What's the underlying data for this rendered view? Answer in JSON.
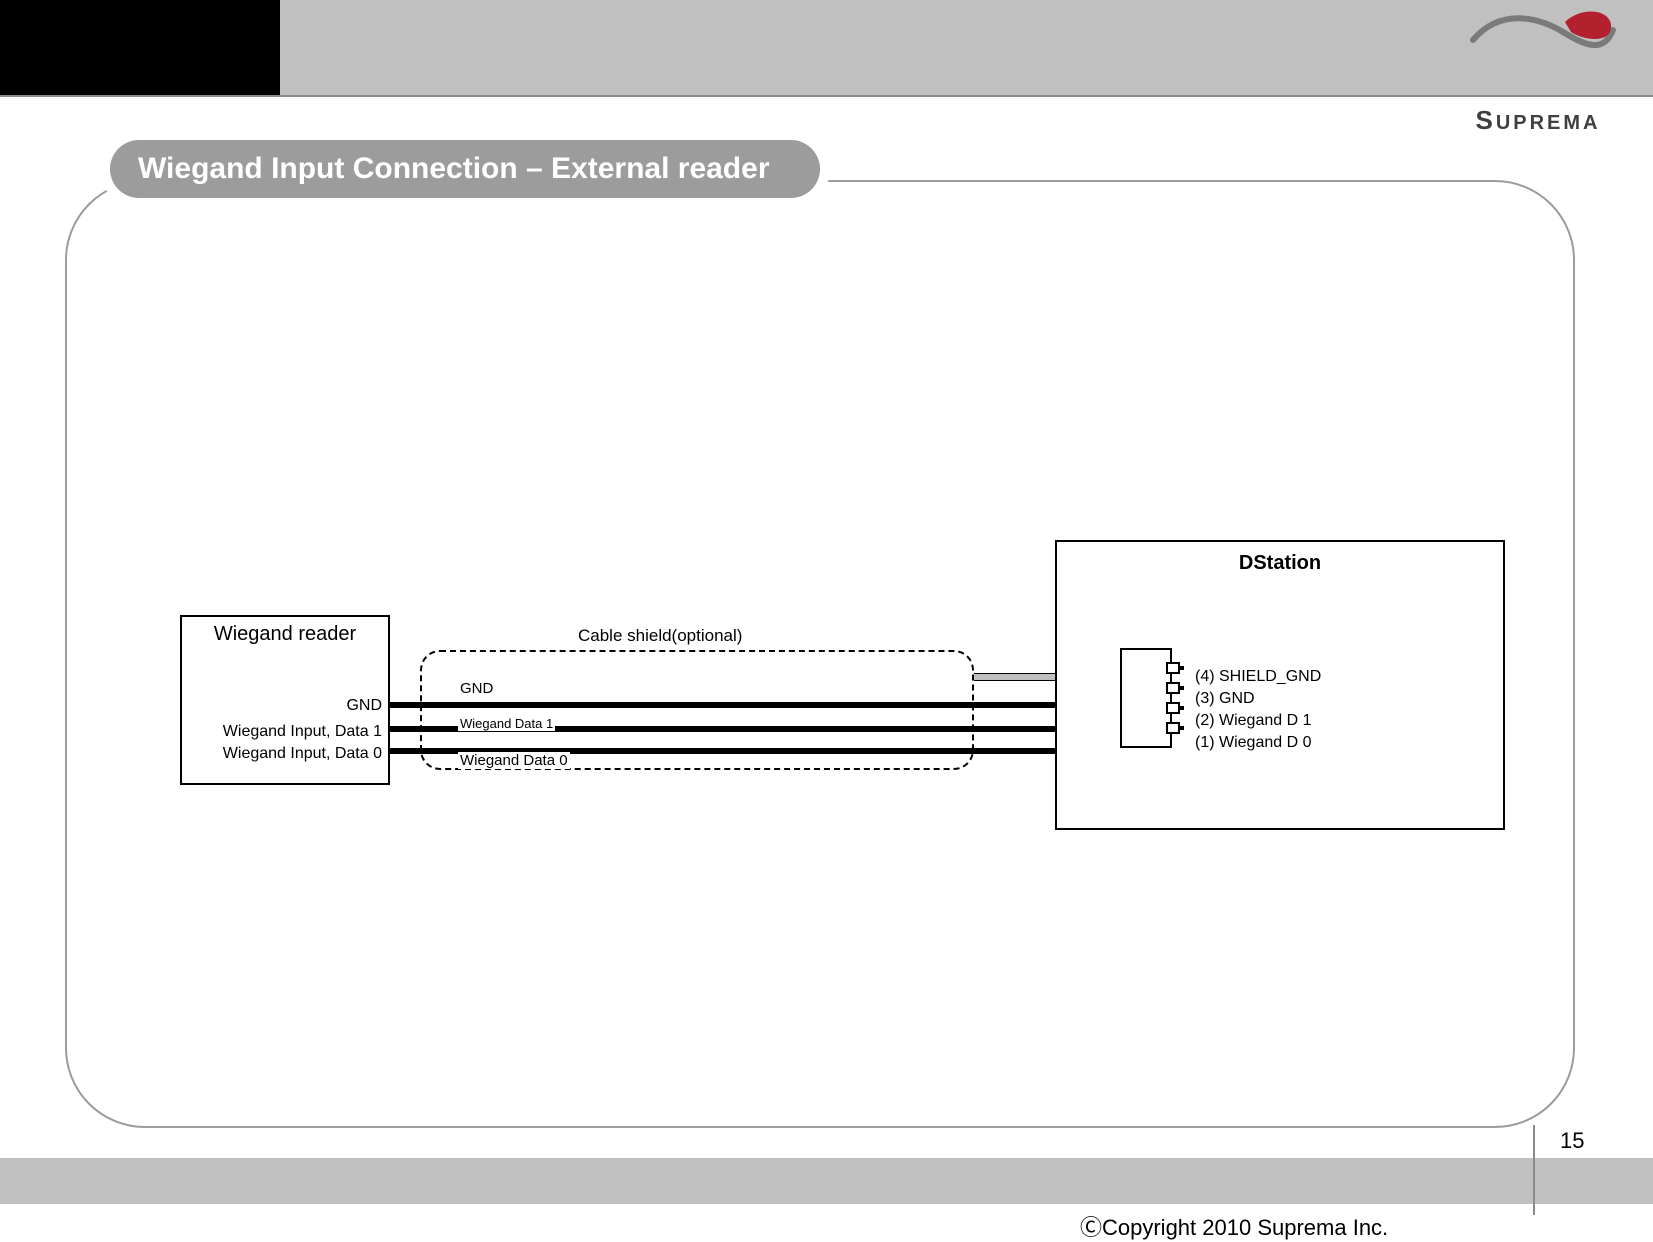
{
  "header": {
    "brand": "SUPREMA",
    "brand_small": "UPREMA"
  },
  "title": "Wiegand Input Connection – External reader",
  "reader": {
    "title": "Wiegand reader",
    "pins": [
      "GND",
      "Wiegand Input, Data 1",
      "Wiegand Input, Data 0"
    ]
  },
  "shield_label": "Cable shield(optional)",
  "wire_labels": [
    "GND",
    "Wiegand Data 1",
    "Wiegand Data 0"
  ],
  "dstation": {
    "title": "DStation",
    "pins": [
      "(4) SHIELD_GND",
      "(3) GND",
      "(2) Wiegand D 1",
      "(1) Wiegand D 0"
    ]
  },
  "footer": {
    "copyright": "ⒸCopyright 2010 Suprema Inc.",
    "page": "15"
  }
}
